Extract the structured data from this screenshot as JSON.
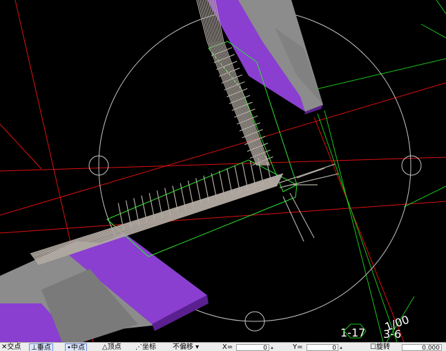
{
  "viewport": {
    "grid_labels": {
      "bottom_left_a": "1-17",
      "bottom_left_b": "3-6",
      "bottom_right_rotated": "1/00"
    },
    "colors": {
      "background": "#000000",
      "axis_red": "#e01010",
      "axis_green": "#18c818",
      "bounding_box": "#2ee62e",
      "rebar": "#b4aca4",
      "beam_purple": "#8a3fd0",
      "beam_gray": "#8c8c8c",
      "circle": "#c8c8c8"
    }
  },
  "toolbar": {
    "mode_label": "交点",
    "vertical_label": "垂点",
    "midpoint_label": "中点",
    "vertex_label": "顶点",
    "coord_label": "坐标",
    "offset_label": "不偏移",
    "x_label": "X=",
    "x_value": "0",
    "y_label": "Y=",
    "y_value": "0",
    "rotate_label": "旋转",
    "rotate_value": "0.000"
  }
}
